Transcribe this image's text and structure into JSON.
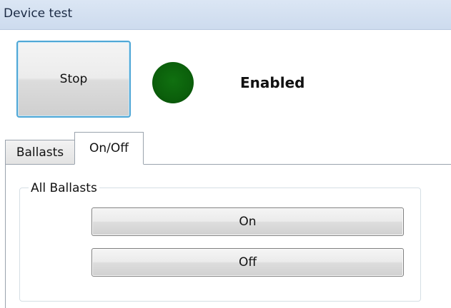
{
  "window": {
    "title": "Device test"
  },
  "controls": {
    "stop_label": "Stop",
    "status_text": "Enabled",
    "status_color": "#0b5f0b"
  },
  "tabs": [
    {
      "label": "Ballasts",
      "selected": false
    },
    {
      "label": "On/Off",
      "selected": true
    }
  ],
  "group": {
    "label": "All Ballasts",
    "on_label": "On",
    "off_label": "Off"
  }
}
